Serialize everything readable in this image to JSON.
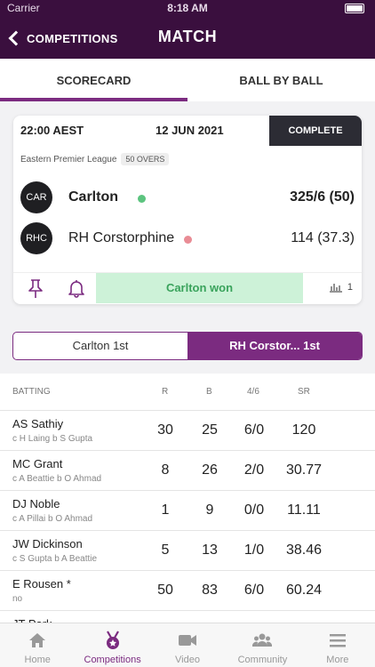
{
  "status_bar": {
    "carrier": "Carrier",
    "time": "8:18 AM"
  },
  "header": {
    "back_label": "COMPETITIONS",
    "title": "MATCH"
  },
  "tabs": [
    {
      "label": "SCORECARD",
      "active": true
    },
    {
      "label": "BALL BY BALL",
      "active": false
    }
  ],
  "match": {
    "time": "22:00 AEST",
    "date": "12 JUN 2021",
    "status": "COMPLETE",
    "competition": "Eastern Premier League",
    "overs_badge": "50 OVERS",
    "teams": [
      {
        "abbr": "CAR",
        "name": "Carlton",
        "score": "325/6 (50)",
        "winner": true,
        "dot_color": "#5cc47f"
      },
      {
        "abbr": "RHC",
        "name": "RH Corstorphine",
        "score": "114 (37.3)",
        "winner": false,
        "dot_color": "#e98c95"
      }
    ],
    "result": "Carlton won",
    "stats_count": "1"
  },
  "innings_toggle": [
    {
      "label": "Carlton 1st",
      "active": false
    },
    {
      "label": "RH Corstor... 1st",
      "active": true
    }
  ],
  "batting": {
    "headers": {
      "batting": "BATTING",
      "r": "R",
      "b": "B",
      "fours_sixes": "4/6",
      "sr": "SR"
    },
    "rows": [
      {
        "name": "AS Sathiy",
        "dismissal": "c H Laing b S Gupta",
        "r": "30",
        "b": "25",
        "fs": "6/0",
        "sr": "120"
      },
      {
        "name": "MC Grant",
        "dismissal": "c A Beattie b O Ahmad",
        "r": "8",
        "b": "26",
        "fs": "2/0",
        "sr": "30.77"
      },
      {
        "name": "DJ Noble",
        "dismissal": "c A Pillai b O Ahmad",
        "r": "1",
        "b": "9",
        "fs": "0/0",
        "sr": "11.11"
      },
      {
        "name": "JW Dickinson",
        "dismissal": "c S Gupta b A Beattie",
        "r": "5",
        "b": "13",
        "fs": "1/0",
        "sr": "38.46"
      },
      {
        "name": "E Rousen *",
        "dismissal": "no",
        "r": "50",
        "b": "83",
        "fs": "6/0",
        "sr": "60.24"
      },
      {
        "name": "JT Park",
        "dismissal": "",
        "r": "",
        "b": "",
        "fs": "",
        "sr": ""
      }
    ]
  },
  "tabbar": [
    {
      "label": "Home",
      "icon": "home-icon",
      "active": false
    },
    {
      "label": "Competitions",
      "icon": "medal-icon",
      "active": true
    },
    {
      "label": "Video",
      "icon": "video-camera-icon",
      "active": false
    },
    {
      "label": "Community",
      "icon": "people-icon",
      "active": false
    },
    {
      "label": "More",
      "icon": "menu-icon",
      "active": false
    }
  ],
  "colors": {
    "header_bg": "#3a0f3e",
    "accent": "#7b2b80",
    "result_bg": "#cdf2d8",
    "result_text": "#3aa35c"
  }
}
